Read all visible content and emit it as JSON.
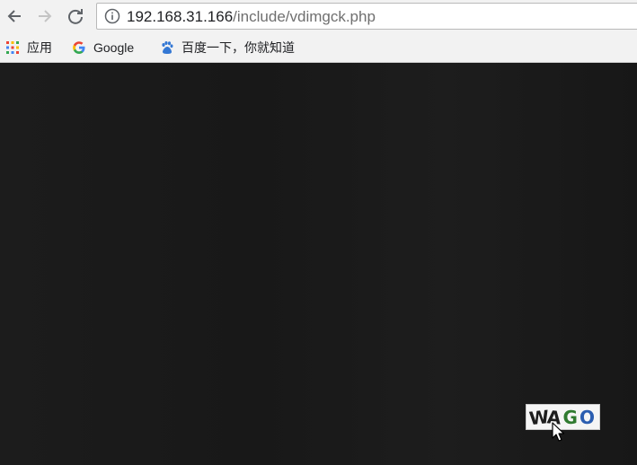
{
  "browser": {
    "address_bar": {
      "host": "192.168.31.166",
      "path": "/include/vdimgck.php"
    },
    "bookmarks": [
      {
        "label": "应用",
        "icon": "apps-grid-icon"
      },
      {
        "label": "Google",
        "icon": "google-icon"
      },
      {
        "label": "百度一下，你就知道",
        "icon": "baidu-paw-icon"
      }
    ]
  },
  "page": {
    "captcha": {
      "chars": [
        "W",
        "A",
        "G",
        "O"
      ],
      "colors": [
        "#1d1d1d",
        "#1d1d1d",
        "#2f7a2f",
        "#2a5db0"
      ]
    }
  },
  "colors": {
    "page_background": "#1a1a1a",
    "chrome_background": "#f2f2f2"
  }
}
